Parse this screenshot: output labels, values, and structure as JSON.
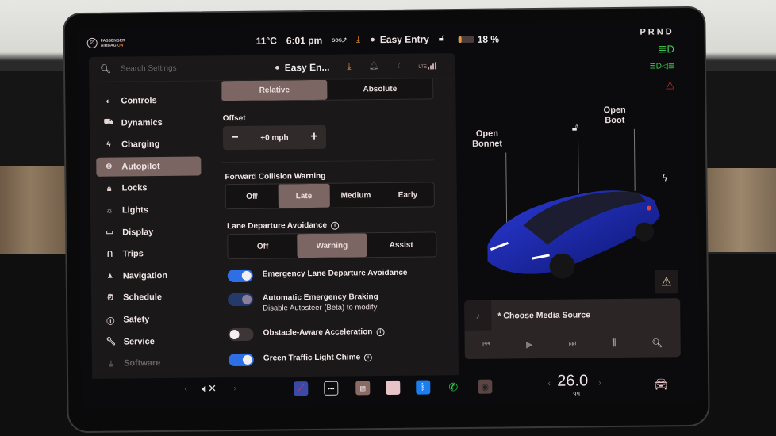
{
  "status_bar": {
    "airbag_line1": "PASSENGER",
    "airbag_line2": "AIRBAG",
    "airbag_state": "ON",
    "temperature": "11°C",
    "time": "6:01 pm",
    "sos_label": "SOS",
    "profile_name": "Easy Entry",
    "battery_percent_label": "18 %",
    "battery_level": 0.18,
    "gear_selector": "PRND",
    "icons": [
      "airbag-icon",
      "sos-icon",
      "download-icon",
      "person-icon",
      "lock-open-icon",
      "battery-icon",
      "headlight-icon",
      "fog-light-icon",
      "seatbelt-warning-icon"
    ]
  },
  "settings_topbar": {
    "search_placeholder": "Search Settings",
    "profile_short": "Easy En...",
    "lte_label": "LTE"
  },
  "sidebar": {
    "items": [
      {
        "label": "Controls",
        "icon": "toggle-icon"
      },
      {
        "label": "Dynamics",
        "icon": "car-icon"
      },
      {
        "label": "Charging",
        "icon": "bolt-icon"
      },
      {
        "label": "Autopilot",
        "icon": "steering-wheel-icon",
        "active": true
      },
      {
        "label": "Locks",
        "icon": "lock-icon"
      },
      {
        "label": "Lights",
        "icon": "sun-icon"
      },
      {
        "label": "Display",
        "icon": "display-icon"
      },
      {
        "label": "Trips",
        "icon": "trips-icon"
      },
      {
        "label": "Navigation",
        "icon": "navigation-icon"
      },
      {
        "label": "Schedule",
        "icon": "alarm-icon"
      },
      {
        "label": "Safety",
        "icon": "safety-icon"
      },
      {
        "label": "Service",
        "icon": "wrench-icon"
      },
      {
        "label": "Software",
        "icon": "download-icon"
      }
    ]
  },
  "autopilot": {
    "speed_mode": {
      "options": [
        "Relative",
        "Absolute"
      ],
      "selected": "Relative"
    },
    "offset": {
      "label": "Offset",
      "value": "+0 mph",
      "minus": "−",
      "plus": "+"
    },
    "forward_collision_warning": {
      "label": "Forward Collision Warning",
      "options": [
        "Off",
        "Late",
        "Medium",
        "Early"
      ],
      "selected": "Late"
    },
    "lane_departure_avoidance": {
      "label": "Lane Departure Avoidance",
      "options": [
        "Off",
        "Warning",
        "Assist"
      ],
      "selected": "Warning"
    },
    "toggles": [
      {
        "label": "Emergency Lane Departure Avoidance",
        "state": "on"
      },
      {
        "label": "Automatic Emergency Braking",
        "sublabel": "Disable Autosteer (Beta) to modify",
        "state": "on-disabled"
      },
      {
        "label": "Obstacle-Aware Acceleration",
        "state": "off",
        "info": true
      },
      {
        "label": "Green Traffic Light Chime",
        "state": "on",
        "info": true
      }
    ]
  },
  "car_view": {
    "open_bonnet_line1": "Open",
    "open_bonnet_line2": "Bonnet",
    "open_boot_line1": "Open",
    "open_boot_line2": "Boot",
    "car_color": "#1a2fb8"
  },
  "media": {
    "title": "* Choose Media Source",
    "controls": [
      "previous-icon",
      "play-icon",
      "next-icon",
      "equalizer-icon",
      "search-icon"
    ]
  },
  "dock": {
    "volume_state": "muted",
    "apps": [
      "navigate-app-icon",
      "more-apps-icon",
      "calendar-app-icon",
      "notes-app-icon",
      "bluetooth-app-icon",
      "phone-app-icon",
      "camera-app-icon"
    ],
    "cabin_temperature": "26.0",
    "seat_heater_label": "ᑫᑫ"
  },
  "colors": {
    "accent_blue": "#2f6fe6",
    "selected_segment": "#7b6663",
    "download_orange": "#e08a30",
    "indicator_green": "#3ecf4f",
    "warning_red": "#e03a3a"
  }
}
